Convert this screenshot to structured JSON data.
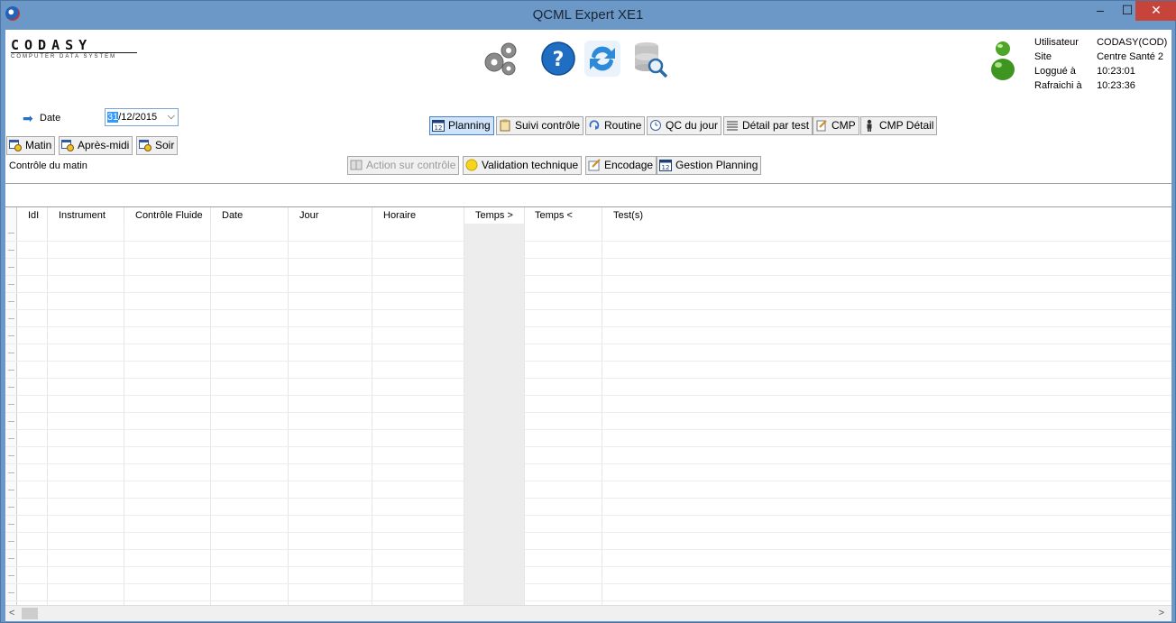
{
  "window": {
    "title": "QCML Expert XE1",
    "min": "–",
    "max": "☐",
    "close": "✕"
  },
  "logo": {
    "main": "CODASY",
    "sub": "COMPUTER DATA SYSTEM"
  },
  "user_info": {
    "rows": [
      {
        "label": "Utilisateur",
        "value": "CODASY(COD)"
      },
      {
        "label": "Site",
        "value": "Centre Santé 2"
      },
      {
        "label": "Loggué à",
        "value": "10:23:01"
      },
      {
        "label": "Rafraichi à",
        "value": "10:23:36"
      }
    ]
  },
  "date": {
    "label": "Date",
    "day": "31",
    "rest": "/12/2015"
  },
  "shift_buttons": {
    "morning": "Matin",
    "afternoon": "Après-midi",
    "evening": "Soir"
  },
  "shift_label": "Contrôle du matin",
  "view_tabs": {
    "planning": "Planning",
    "suivi": "Suivi contrôle",
    "routine": "Routine",
    "qc_jour": "QC du jour",
    "detail_test": "Détail par test",
    "cmp": "CMP",
    "cmp_detail": "CMP Détail"
  },
  "action_buttons": {
    "action_controle": "Action sur contrôle",
    "validation": "Validation technique",
    "encodage": "Encodage",
    "gestion_planning": "Gestion Planning"
  },
  "grid": {
    "columns": [
      "IdI",
      "Instrument",
      "Contrôle Fluide",
      "Date",
      "Jour",
      "Horaire",
      "Temps >",
      "Temps <",
      "Test(s)"
    ],
    "row_count": 22
  },
  "colors": {
    "title_bar": "#6b98c6",
    "close_button": "#c7443b",
    "active_tab": "#cfe3fa"
  }
}
